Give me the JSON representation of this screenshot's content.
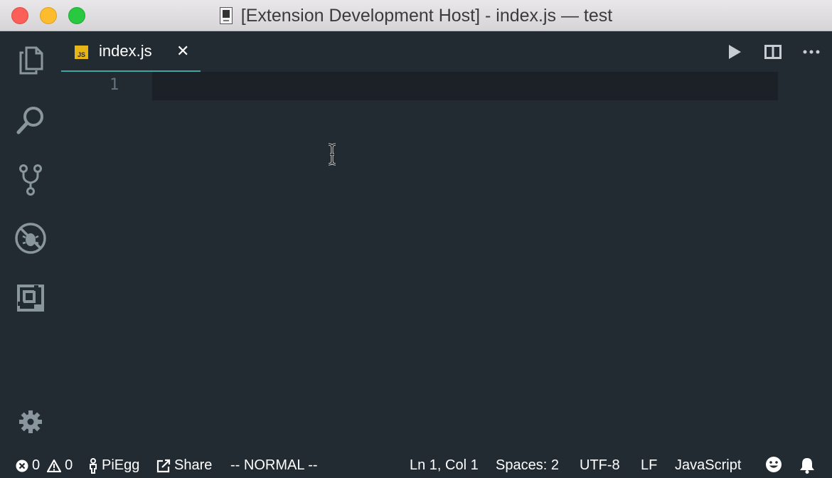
{
  "window": {
    "title": "[Extension Development Host] - index.js — test"
  },
  "activity_bar": {
    "items": [
      {
        "icon": "files-icon"
      },
      {
        "icon": "search-icon"
      },
      {
        "icon": "source-control-icon"
      },
      {
        "icon": "debug-icon"
      },
      {
        "icon": "extensions-icon"
      }
    ],
    "bottom": {
      "icon": "gear-icon"
    }
  },
  "tabs": [
    {
      "badge": "JS",
      "label": "index.js",
      "close": "✕",
      "active": true
    }
  ],
  "tab_actions": [
    {
      "icon": "run-icon"
    },
    {
      "icon": "split-editor-icon"
    },
    {
      "icon": "more-icon"
    }
  ],
  "editor": {
    "line_numbers": [
      "1"
    ]
  },
  "status_bar": {
    "errors": "0",
    "warnings": "0",
    "user": "PiEgg",
    "share": "Share",
    "mode": "-- NORMAL --",
    "position": "Ln 1, Col 1",
    "indent": "Spaces: 2",
    "encoding": "UTF-8",
    "eol": "LF",
    "language": "JavaScript"
  },
  "colors": {
    "background": "#222b32",
    "current_line": "#1b2126",
    "tab_accent": "#3fa5a0",
    "js_badge": "#e8b516",
    "icon": "#8a969e"
  }
}
